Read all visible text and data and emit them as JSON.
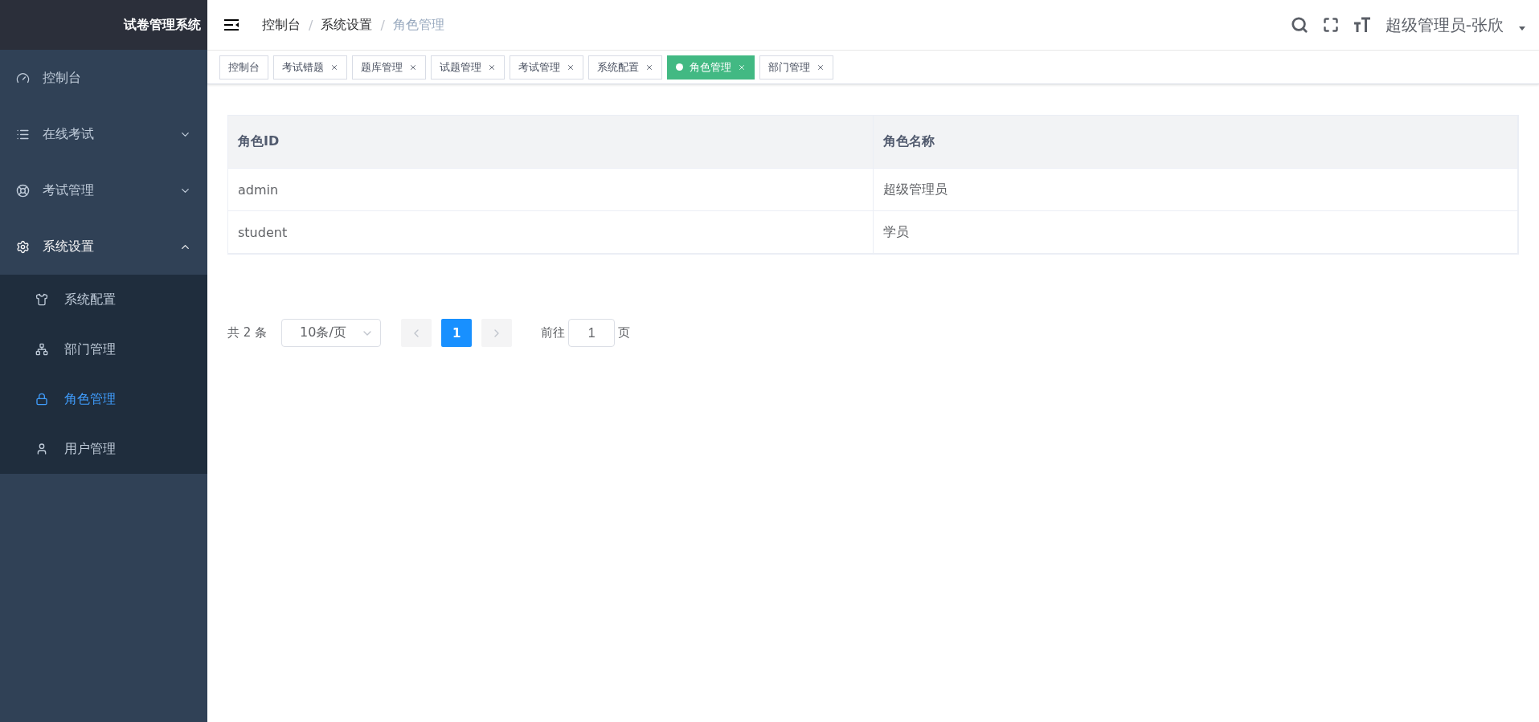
{
  "app": {
    "title": "试卷管理系统"
  },
  "sidebar": {
    "items": [
      {
        "label": "控制台",
        "kind": "link"
      },
      {
        "label": "在线考试",
        "kind": "group",
        "expanded": false
      },
      {
        "label": "考试管理",
        "kind": "group",
        "expanded": false
      },
      {
        "label": "系统设置",
        "kind": "group",
        "expanded": true,
        "children": [
          {
            "label": "系统配置",
            "selected": false
          },
          {
            "label": "部门管理",
            "selected": false
          },
          {
            "label": "角色管理",
            "selected": true
          },
          {
            "label": "用户管理",
            "selected": false
          }
        ]
      }
    ]
  },
  "breadcrumb": {
    "separator": "/",
    "items": [
      "控制台",
      "系统设置",
      "角色管理"
    ]
  },
  "user": {
    "name": "超级管理员-张欣"
  },
  "tabs": [
    {
      "label": "控制台",
      "selected": false,
      "kind": "fixed"
    },
    {
      "label": "考试错题",
      "selected": false,
      "kind": "closable"
    },
    {
      "label": "题库管理",
      "selected": false,
      "kind": "closable"
    },
    {
      "label": "试题管理",
      "selected": false,
      "kind": "closable"
    },
    {
      "label": "考试管理",
      "selected": false,
      "kind": "closable"
    },
    {
      "label": "系统配置",
      "selected": false,
      "kind": "closable"
    },
    {
      "label": "角色管理",
      "selected": true,
      "kind": "closable"
    },
    {
      "label": "部门管理",
      "selected": false,
      "kind": "closable"
    }
  ],
  "table": {
    "columns": [
      "角色ID",
      "角色名称"
    ],
    "rows": [
      [
        "admin",
        "超级管理员"
      ],
      [
        "student",
        "学员"
      ]
    ]
  },
  "pagination": {
    "total": "共 2 条",
    "page_size": "10条/页",
    "pages": [
      {
        "label": "1",
        "selected": true
      }
    ],
    "goto_label": "前往",
    "goto_value": "1",
    "goto_suffix": "页"
  }
}
